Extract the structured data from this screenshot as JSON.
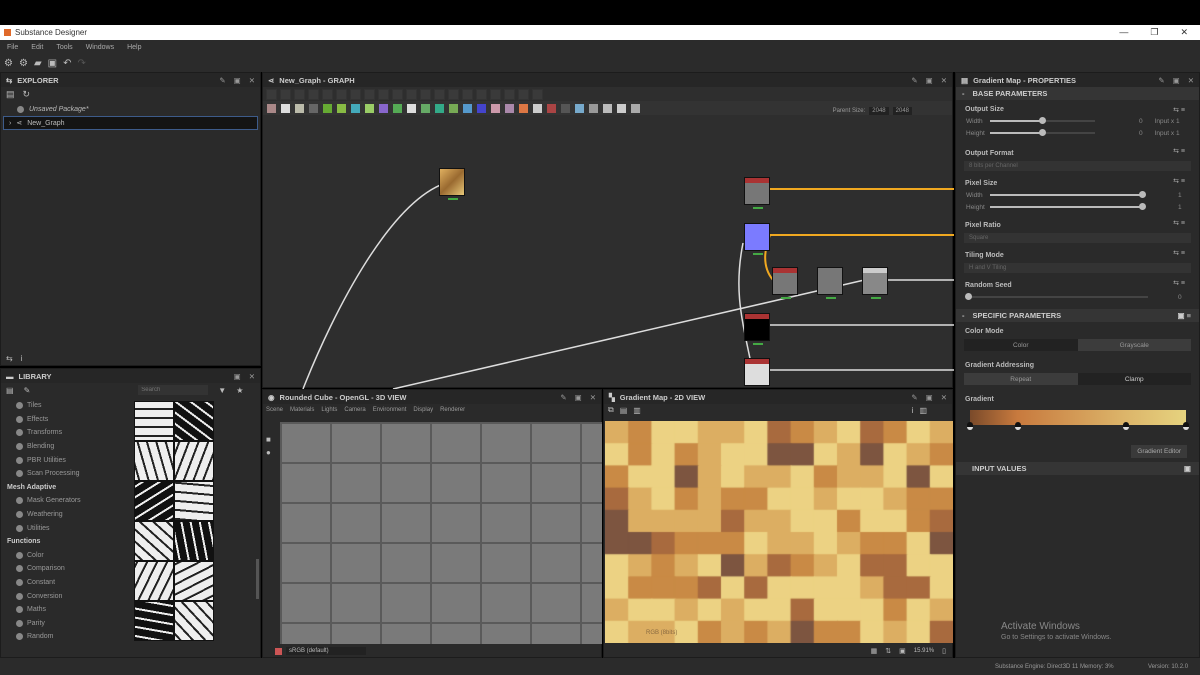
{
  "app": {
    "title": "Substance Designer",
    "window_buttons": [
      "—",
      "❐",
      "✕"
    ]
  },
  "menu": [
    "File",
    "Edit",
    "Tools",
    "Windows",
    "Help"
  ],
  "explorer": {
    "title": "EXPLORER",
    "package": "Unsaved Package*",
    "graph": "New_Graph"
  },
  "library": {
    "title": "LIBRARY",
    "search_placeholder": "Search",
    "items": [
      {
        "label": "Tiles",
        "cat": false
      },
      {
        "label": "Effects",
        "cat": false
      },
      {
        "label": "Transforms",
        "cat": false
      },
      {
        "label": "Blending",
        "cat": false
      },
      {
        "label": "PBR Utilities",
        "cat": false
      },
      {
        "label": "Scan Processing",
        "cat": false
      },
      {
        "label": "Mesh Adaptive",
        "cat": true
      },
      {
        "label": "Mask Generators",
        "cat": false
      },
      {
        "label": "Weathering",
        "cat": false
      },
      {
        "label": "Utilities",
        "cat": false
      },
      {
        "label": "Functions",
        "cat": true
      },
      {
        "label": "Color",
        "cat": false
      },
      {
        "label": "Comparison",
        "cat": false
      },
      {
        "label": "Constant",
        "cat": false
      },
      {
        "label": "Conversion",
        "cat": false
      },
      {
        "label": "Maths",
        "cat": false
      },
      {
        "label": "Parity",
        "cat": false
      },
      {
        "label": "Random",
        "cat": false
      }
    ]
  },
  "graph": {
    "title": "New_Graph - GRAPH",
    "parent_size_label": "Parent Size:",
    "parent_size": "2048",
    "size2": "2048"
  },
  "view3d": {
    "title": "Rounded Cube - OpenGL - 3D VIEW",
    "menu": [
      "Scene",
      "Materials",
      "Lights",
      "Camera",
      "Environment",
      "Display",
      "Renderer"
    ],
    "colorspace": "sRGB (default)"
  },
  "view2d": {
    "title": "Gradient Map - 2D VIEW",
    "zoom": "15.91%",
    "overlay": "RGB (8bits)",
    "palette": [
      "#ecd283",
      "#dcae62",
      "#c98a45",
      "#a86a3e",
      "#7d5540"
    ]
  },
  "properties": {
    "title": "Gradient Map - PROPERTIES",
    "base": "BASE PARAMETERS",
    "output_size": "Output Size",
    "width": "Width",
    "height": "Height",
    "os_w": "0",
    "os_h": "0",
    "os_w_rel": "Input x 1",
    "os_h_rel": "Input x 1",
    "os_fraction": 0.5,
    "output_format": "Output Format",
    "output_format_val": "8 bits per Channel",
    "pixel_size": "Pixel Size",
    "ps_w": "1",
    "ps_h": "1",
    "ps_fraction": 1.0,
    "pixel_ratio": "Pixel Ratio",
    "pixel_ratio_val": "Square",
    "tiling_mode": "Tiling Mode",
    "tiling_mode_val": "H and V Tiling",
    "random_seed": "Random Seed",
    "seed": "0",
    "specific": "SPECIFIC PARAMETERS",
    "color_mode": "Color Mode",
    "color_mode_opts": [
      "Color",
      "Grayscale"
    ],
    "addressing": "Gradient Addressing",
    "addressing_opts": [
      "Repeat",
      "Clamp"
    ],
    "gradient": "Gradient",
    "gradient_stops": [
      {
        "pos": 0,
        "color": "#7a4a2a"
      },
      {
        "pos": 0.22,
        "color": "#c87a3e"
      },
      {
        "pos": 0.72,
        "color": "#dcb56a"
      },
      {
        "pos": 1,
        "color": "#e6d37f"
      }
    ],
    "gradient_editor": "Gradient Editor",
    "input_values": "INPUT VALUES"
  },
  "watermark": {
    "activate": "Activate Windows",
    "activate_sub": "Go to Settings to activate Windows."
  },
  "status": {
    "engine": "Substance Engine: Direct3D 11  Memory: 3%",
    "version": "Version: 10.2.0"
  }
}
